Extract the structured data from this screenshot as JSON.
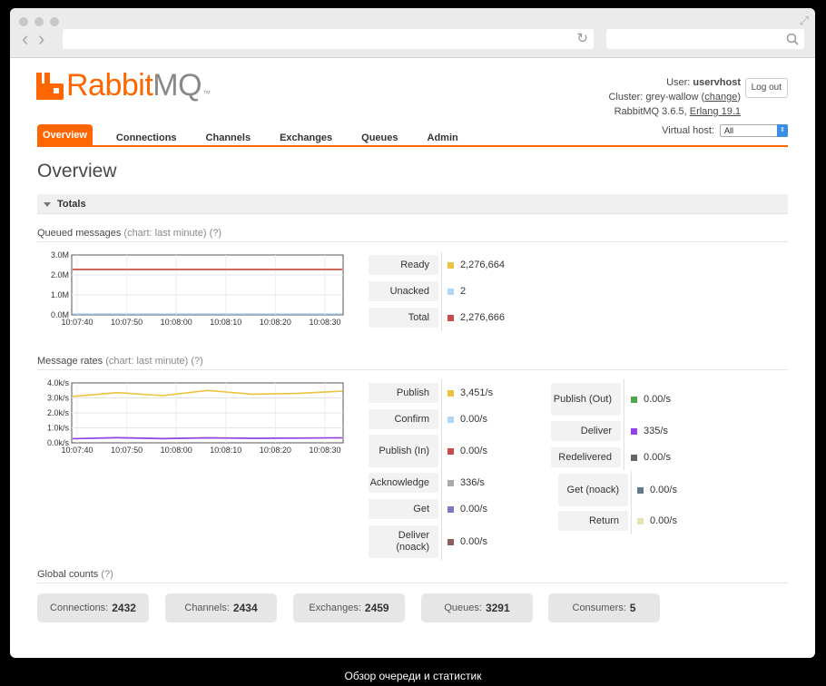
{
  "browser": {},
  "header": {
    "logo_rabbit": "Rabbit",
    "logo_mq": "MQ",
    "logo_tm": "™",
    "user_label": "User:",
    "user": "uservhost",
    "cluster_label": "Cluster:",
    "cluster": "grey-wallow",
    "change_link": "change",
    "version_text": "RabbitMQ 3.6.5,",
    "erlang_link": "Erlang 19.1",
    "logout": "Log out",
    "vhost_label": "Virtual host:",
    "vhost_value": "All"
  },
  "tabs": [
    "Overview",
    "Connections",
    "Channels",
    "Exchanges",
    "Queues",
    "Admin"
  ],
  "page_title": "Overview",
  "totals": {
    "label": "Totals"
  },
  "queued": {
    "title": "Queued messages",
    "sub": "(chart: last minute)",
    "help": "(?)",
    "y_ticks": [
      "3.0M",
      "2.0M",
      "1.0M",
      "0.0M"
    ],
    "x_ticks": [
      "10:07:40",
      "10:07:50",
      "10:08:00",
      "10:08:10",
      "10:08:20",
      "10:08:30"
    ],
    "stats": [
      {
        "label": "Ready",
        "value": "2,276,664",
        "color": "#edc240"
      },
      {
        "label": "Unacked",
        "value": "2",
        "color": "#afd8f8"
      },
      {
        "label": "Total",
        "value": "2,276,666",
        "color": "#cb4b4b"
      }
    ]
  },
  "rates": {
    "title": "Message rates",
    "sub": "(chart: last minute)",
    "help": "(?)",
    "y_ticks": [
      "4.0k/s",
      "3.0k/s",
      "2.0k/s",
      "1.0k/s",
      "0.0k/s"
    ],
    "x_ticks": [
      "10:07:40",
      "10:07:50",
      "10:08:00",
      "10:08:10",
      "10:08:20",
      "10:08:30"
    ],
    "col1": [
      {
        "label": "Publish",
        "value": "3,451/s",
        "color": "#edc240"
      },
      {
        "label": "Confirm",
        "value": "0.00/s",
        "color": "#afd8f8"
      },
      {
        "label": "Publish (In)",
        "value": "0.00/s",
        "color": "#cb4b4b"
      },
      {
        "label": "Acknowledge",
        "value": "336/s",
        "color": "#aaaaaa"
      },
      {
        "label": "Get",
        "value": "0.00/s",
        "color": "#7c79c3"
      },
      {
        "label": "Deliver (noack)",
        "value": "0.00/s",
        "color": "#8c5e5e"
      }
    ],
    "col2": [
      {
        "label": "Publish (Out)",
        "value": "0.00/s",
        "color": "#4da74d"
      },
      {
        "label": "Deliver",
        "value": "335/s",
        "color": "#9440ed"
      },
      {
        "label": "Redelivered",
        "value": "0.00/s",
        "color": "#666666"
      },
      {
        "label": "Get (noack)",
        "value": "0.00/s",
        "color": "#637a89"
      },
      {
        "label": "Return",
        "value": "0.00/s",
        "color": "#e7e2b3"
      }
    ]
  },
  "global": {
    "title": "Global counts",
    "help": "(?)",
    "items": [
      {
        "label": "Connections:",
        "value": "2432"
      },
      {
        "label": "Channels:",
        "value": "2434"
      },
      {
        "label": "Exchanges:",
        "value": "2459"
      },
      {
        "label": "Queues:",
        "value": "3291"
      },
      {
        "label": "Consumers:",
        "value": "5"
      }
    ]
  },
  "caption": "Обзор очереди и статистик",
  "chart_data": [
    {
      "type": "line",
      "x": [
        "10:07:40",
        "10:07:50",
        "10:08:00",
        "10:08:10",
        "10:08:20",
        "10:08:30"
      ],
      "ylim": [
        0,
        3000000
      ],
      "series": [
        {
          "name": "Ready",
          "values": [
            2276664,
            2276664,
            2276664,
            2276664,
            2276664,
            2276664
          ]
        },
        {
          "name": "Total",
          "values": [
            2276666,
            2276666,
            2276666,
            2276666,
            2276666,
            2276666
          ]
        },
        {
          "name": "Unacked",
          "values": [
            2,
            2,
            2,
            2,
            2,
            2
          ]
        }
      ]
    },
    {
      "type": "line",
      "x": [
        "10:07:40",
        "10:07:50",
        "10:08:00",
        "10:08:10",
        "10:08:20",
        "10:08:30"
      ],
      "ylim": [
        0,
        4000
      ],
      "series": [
        {
          "name": "Publish",
          "values": [
            3100,
            3350,
            3150,
            3500,
            3250,
            3300,
            3450
          ]
        },
        {
          "name": "Acknowledge",
          "values": [
            280,
            350,
            290,
            340,
            300,
            320,
            336
          ]
        },
        {
          "name": "Deliver",
          "values": [
            270,
            340,
            280,
            330,
            295,
            315,
            335
          ]
        }
      ]
    }
  ]
}
